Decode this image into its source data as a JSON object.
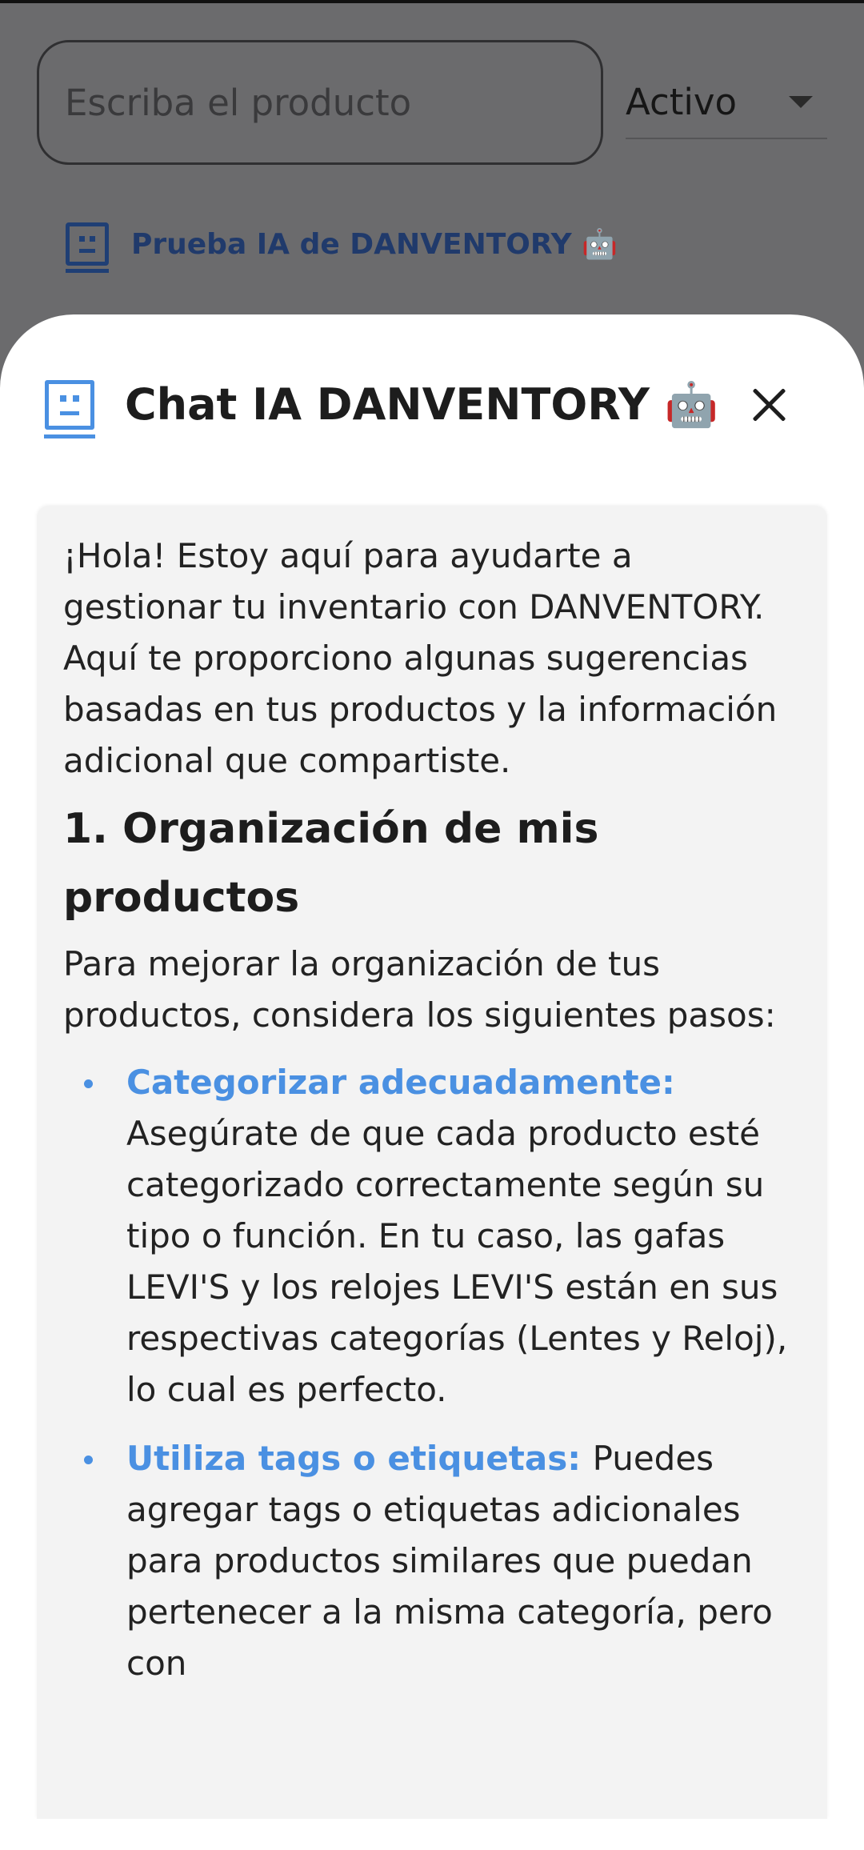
{
  "search": {
    "placeholder": "Escriba el producto"
  },
  "status_filter": {
    "selected": "Activo"
  },
  "ai_link": {
    "label": "Prueba IA de DANVENTORY 🤖"
  },
  "chat": {
    "title": "Chat IA DANVENTORY 🤖",
    "intro": "¡Hola! Estoy aquí para ayudarte a gestionar tu inventario con DANVENTORY. Aquí te proporciono algunas sugerencias basadas en tus productos y la información adicional que compartiste.",
    "section_heading": "1. Organización de mis productos",
    "section_intro": "Para mejorar la organización de tus productos, considera los siguientes pasos:",
    "bullets": [
      {
        "title": "Categorizar adecuadamente:",
        "text": "Asegúrate de que cada producto esté categorizado correctamente según su tipo o función. En tu caso, las gafas LEVI'S y los relojes LEVI'S están en sus respectivas categorías (Lentes y Reloj), lo cual es perfecto."
      },
      {
        "title": "Utiliza tags o etiquetas:",
        "text": "Puedes agregar tags o etiquetas adicionales para productos similares que puedan pertenecer a la misma categoría, pero con"
      }
    ]
  },
  "colors": {
    "accent": "#4a90e2",
    "overlay": "#6b6b6d",
    "card": "#f3f3f3"
  },
  "icons": {
    "ai": "bot-face-icon",
    "close": "close-icon",
    "dropdown": "caret-down-icon"
  }
}
